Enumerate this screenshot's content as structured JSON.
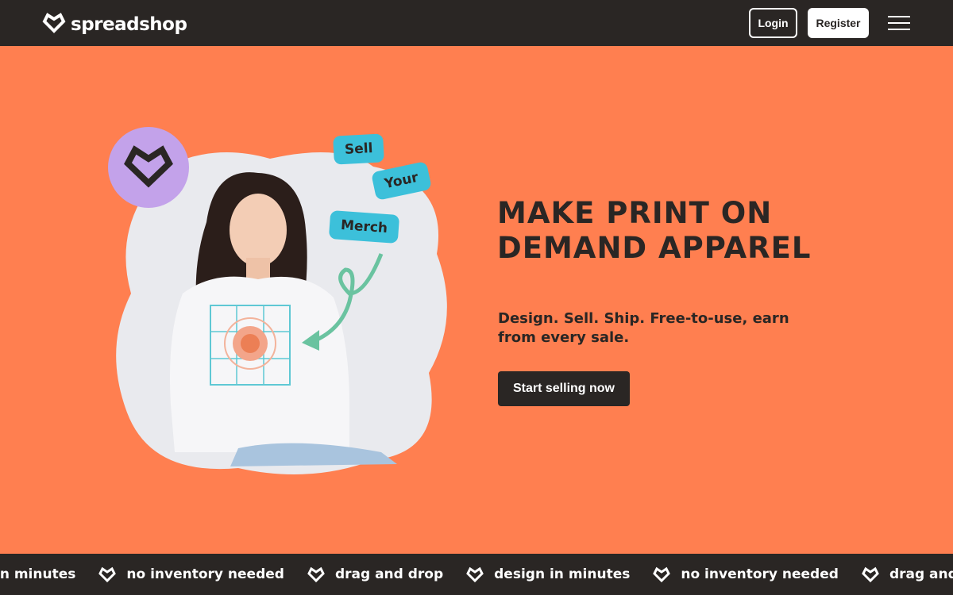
{
  "header": {
    "logo_text": "spreadshop",
    "login_label": "Login",
    "register_label": "Register"
  },
  "hero": {
    "tags": {
      "sell": "Sell",
      "your": "Your",
      "merch": "Merch"
    },
    "headline": "MAKE PRINT ON DEMAND APPAREL",
    "subline": "Design. Sell. Ship. Free-to-use, earn from every sale.",
    "cta_label": "Start selling now"
  },
  "marquee": {
    "items": [
      "in minutes",
      "no inventory needed",
      "drag and drop",
      "design in minutes",
      "no inventory needed",
      "drag and drop"
    ]
  },
  "colors": {
    "background": "#ff7f50",
    "dark": "#2a2624",
    "tag": "#3cc0da",
    "badge": "#c3a2ea",
    "arrow": "#6ac3a0"
  }
}
